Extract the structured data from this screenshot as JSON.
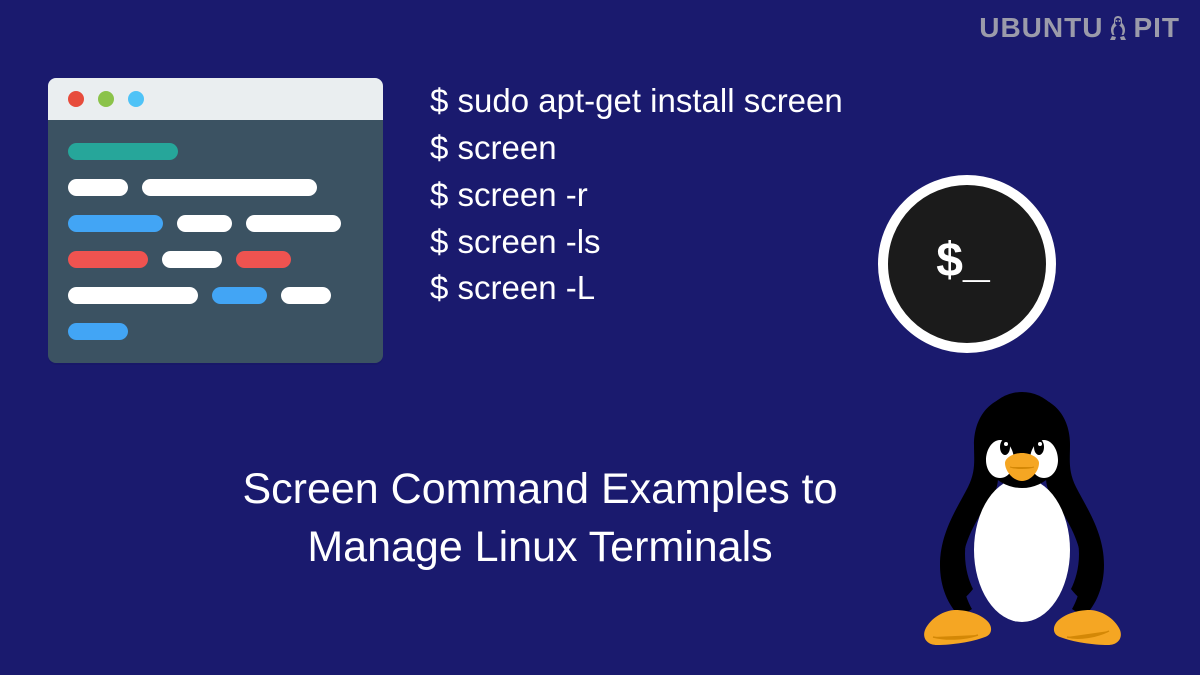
{
  "watermark": {
    "left": "UBUNTU",
    "right": "PIT"
  },
  "commands": [
    "$ sudo apt-get install screen",
    "$ screen",
    "$ screen -r",
    "$ screen -ls",
    "$ screen -L"
  ],
  "shell_prompt": "$_",
  "title": {
    "line1": "Screen Command Examples to",
    "line2": "Manage Linux Terminals"
  }
}
